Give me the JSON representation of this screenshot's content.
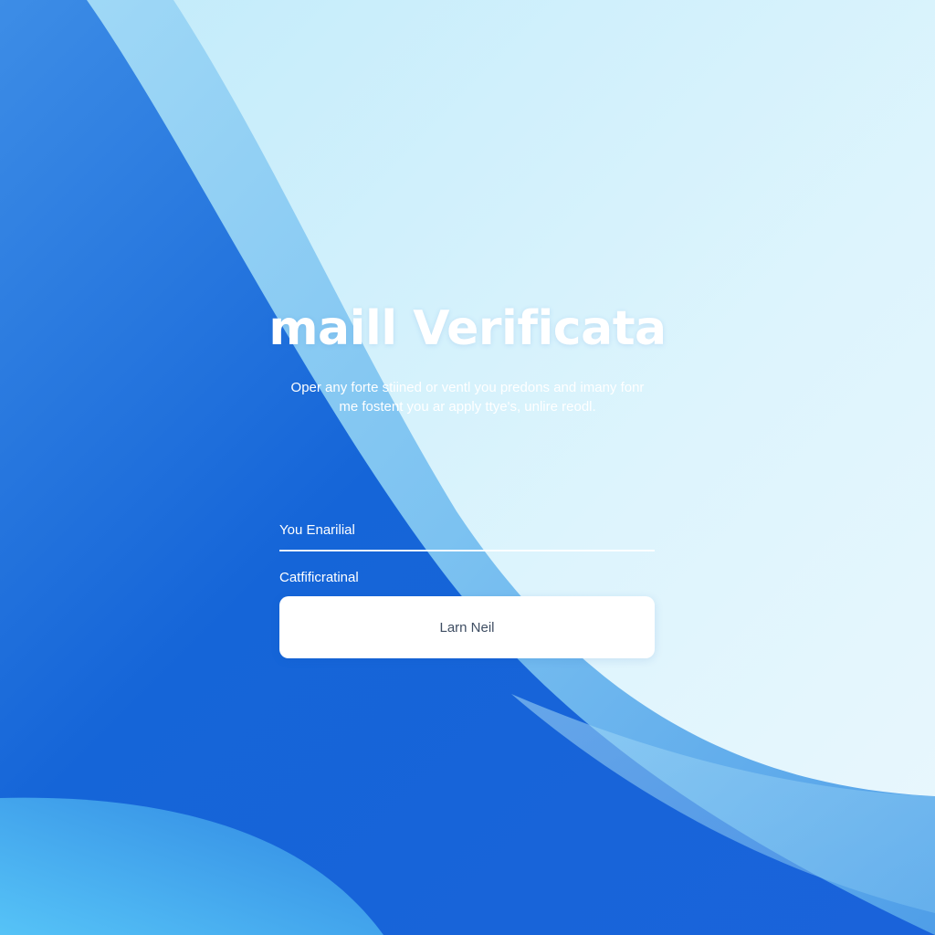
{
  "verification": {
    "title": "maill Verificata",
    "subtitle_line1": "Oper any forte stiined or ventl you predons and imany fonr",
    "subtitle_line2": "me fostent you ar apply ttye's, unlire reodl.",
    "email_label": "You Enarilial",
    "code_label": "Catfificratinal",
    "submit_label": "Larn Neil"
  },
  "colors": {
    "deep_blue": "#1565d8",
    "light_cyan": "#e9fbfe",
    "button_bg": "#ffffff",
    "button_text": "#3f4e63"
  }
}
